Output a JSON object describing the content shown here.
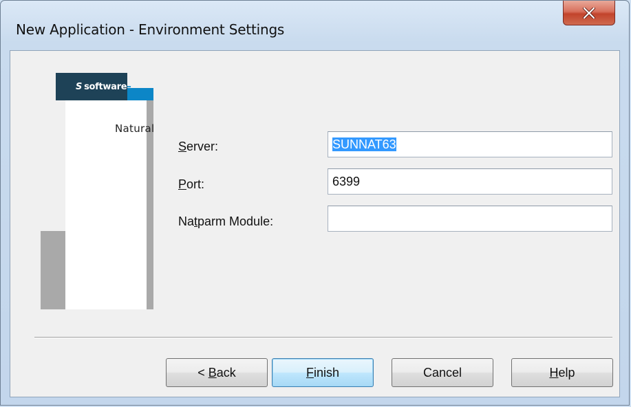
{
  "window": {
    "title": "New Application - Environment Settings",
    "close_icon": "close-x-icon"
  },
  "logo": {
    "brand_text": "software",
    "product_text": "Natural",
    "colors": {
      "dark": "#1e4257",
      "blue": "#0c86c7",
      "grey": "#a9a9a9"
    }
  },
  "form": {
    "server": {
      "label_ul": "S",
      "label_rest": "erver:",
      "value": "SUNNAT63"
    },
    "port": {
      "label_ul": "P",
      "label_rest": "ort:",
      "value": "6399"
    },
    "natparm": {
      "label_pre": "Na",
      "label_ul": "t",
      "label_rest": "parm Module:",
      "value": ""
    }
  },
  "buttons": {
    "back": {
      "pre": "< ",
      "ul": "B",
      "rest": "ack"
    },
    "finish": {
      "pre": "",
      "ul": "F",
      "rest": "inish"
    },
    "cancel": {
      "label": "Cancel"
    },
    "help": {
      "pre": "",
      "ul": "H",
      "rest": "elp"
    }
  }
}
